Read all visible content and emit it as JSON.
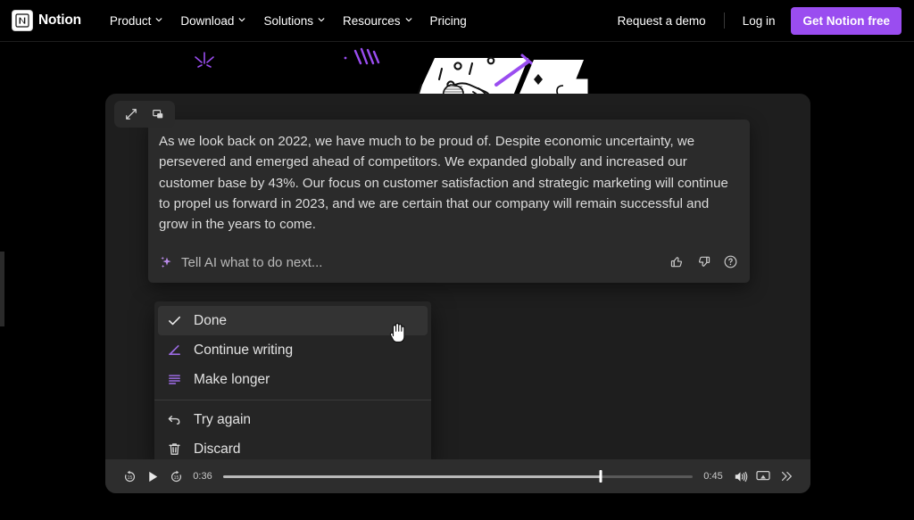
{
  "navbar": {
    "brand": "Notion",
    "links": [
      {
        "label": "Product",
        "caret": true
      },
      {
        "label": "Download",
        "caret": true
      },
      {
        "label": "Solutions",
        "caret": true
      },
      {
        "label": "Resources",
        "caret": true
      },
      {
        "label": "Pricing",
        "caret": false
      }
    ],
    "request_demo": "Request a demo",
    "login": "Log in",
    "cta": "Get Notion free",
    "cta_color": "#9a4df0",
    "background": "#000000"
  },
  "player": {
    "top_controls": [
      {
        "name": "expand-icon",
        "label": "Expand"
      },
      {
        "name": "picture-in-picture-icon",
        "label": "Picture in picture"
      }
    ],
    "ai_card": {
      "body": "As we look back on 2022, we have much to be proud of. Despite economic uncertainty, we persevered and emerged ahead of competitors. We expanded globally and increased our customer base by 43%. Our focus on customer satisfaction and strategic marketing will continue to propel us forward in 2023, and we are certain that our company will remain successful and grow in the years to come.",
      "prompt_placeholder": "Tell AI what to do next...",
      "actions": [
        {
          "name": "thumbs-up-icon",
          "label": "Good response"
        },
        {
          "name": "thumbs-down-icon",
          "label": "Bad response"
        },
        {
          "name": "help-icon",
          "label": "Help"
        }
      ]
    },
    "menu": {
      "items": [
        {
          "label": "Done",
          "icon": "check-icon",
          "active": true
        },
        {
          "label": "Continue writing",
          "icon": "pencil-icon",
          "active": false
        },
        {
          "label": "Make longer",
          "icon": "lines-icon",
          "active": false
        }
      ],
      "items_secondary": [
        {
          "label": "Try again",
          "icon": "undo-icon",
          "active": false
        },
        {
          "label": "Discard",
          "icon": "trash-icon",
          "active": false
        }
      ],
      "accent_color": "#9a6ae0"
    },
    "controls": {
      "rewind_label": "15",
      "forward_label": "15",
      "current_time": "0:36",
      "remaining_time": "0:45",
      "progress_percent": 80.5,
      "buttons": [
        {
          "name": "rewind-15-icon"
        },
        {
          "name": "play-icon"
        },
        {
          "name": "forward-15-icon"
        },
        {
          "name": "volume-icon"
        },
        {
          "name": "airplay-icon"
        },
        {
          "name": "more-icon"
        }
      ]
    }
  }
}
